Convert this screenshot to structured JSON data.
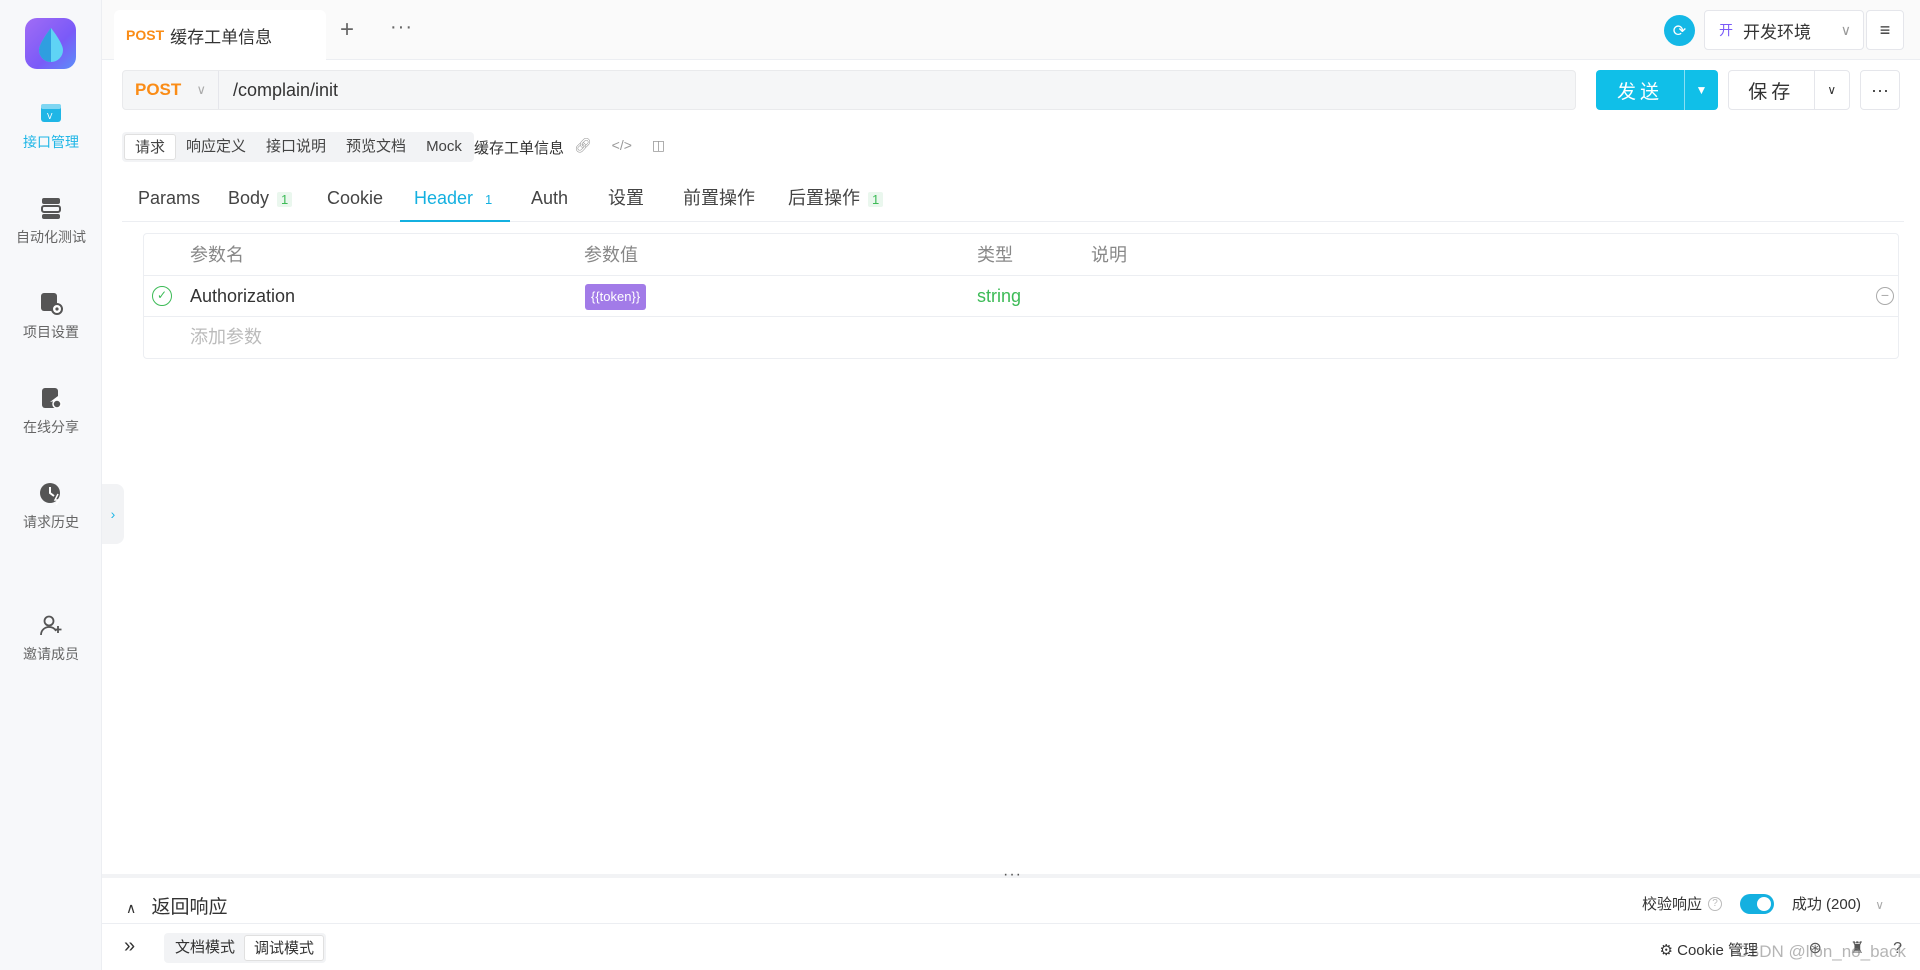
{
  "sidebar": {
    "items": [
      {
        "label": "接口管理",
        "icon": "api-management-icon",
        "active": true
      },
      {
        "label": "自动化测试",
        "icon": "automation-test-icon",
        "active": false
      },
      {
        "label": "项目设置",
        "icon": "project-settings-icon",
        "active": false
      },
      {
        "label": "在线分享",
        "icon": "online-share-icon",
        "active": false
      },
      {
        "label": "请求历史",
        "icon": "request-history-icon",
        "active": false
      },
      {
        "label": "邀请成员",
        "icon": "invite-member-icon",
        "active": false
      }
    ]
  },
  "tabs": {
    "active": {
      "method": "POST",
      "title": "缓存工单信息"
    },
    "add": "+",
    "more": "···"
  },
  "env": {
    "badge": "开",
    "label": "开发环境"
  },
  "request": {
    "method": "POST",
    "url": "/complain/init",
    "send_label": "发送",
    "save_label": "保存"
  },
  "subtabs": {
    "items": [
      "请求",
      "响应定义",
      "接口说明",
      "预览文档",
      "Mock"
    ],
    "active": "请求",
    "breadcrumb": "缓存工单信息"
  },
  "req_tabs": [
    {
      "label": "Params",
      "count": ""
    },
    {
      "label": "Body",
      "count": "1"
    },
    {
      "label": "Cookie",
      "count": ""
    },
    {
      "label": "Header",
      "count": "1",
      "active": true
    },
    {
      "label": "Auth",
      "count": ""
    },
    {
      "label": "设置",
      "count": ""
    },
    {
      "label": "前置操作",
      "count": ""
    },
    {
      "label": "后置操作",
      "count": "1"
    }
  ],
  "params_table": {
    "columns": [
      "参数名",
      "参数值",
      "类型",
      "说明"
    ],
    "rows": [
      {
        "name": "Authorization",
        "value": "{{token}}",
        "type": "string",
        "desc": "",
        "enabled": true
      }
    ],
    "add_placeholder": "添加参数"
  },
  "response": {
    "title": "返回响应",
    "validate_label": "校验响应",
    "validate_on": true,
    "status": "成功 (200)"
  },
  "footer": {
    "modes": [
      "文档模式",
      "调试模式"
    ],
    "active_mode": "调试模式",
    "cookie_label": "Cookie 管理",
    "watermark": "CSDN @lion_no_back"
  },
  "colors": {
    "accent": "#14b0e0",
    "method_post": "#fa8c16",
    "success": "#3dbb57",
    "token_badge": "#a27be8"
  }
}
